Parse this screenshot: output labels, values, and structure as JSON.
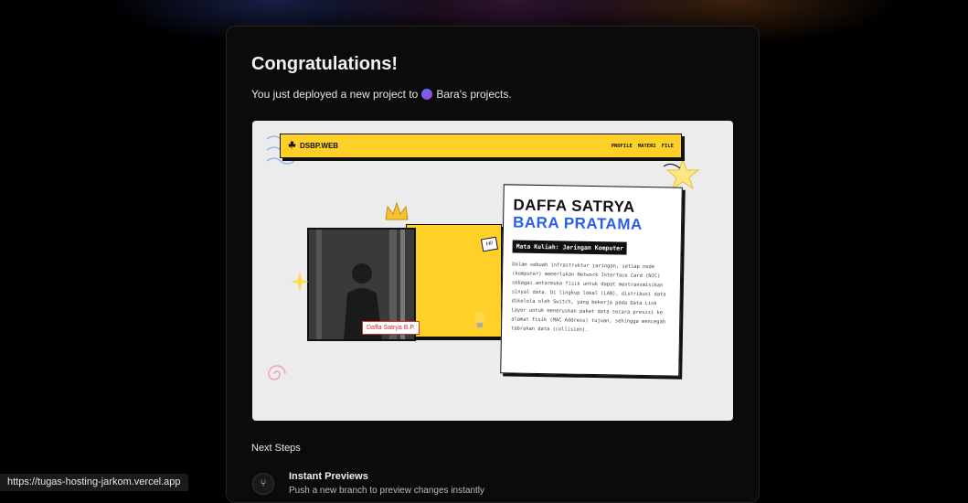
{
  "header": {
    "title": "Congratulations!",
    "subtitle_prefix": "You just deployed a new project to",
    "team_name": "Bara's projects."
  },
  "preview": {
    "brand": "DSBP.WEB",
    "nav": [
      "PROFILE",
      "MATERI",
      "FILE"
    ],
    "hi": "Hi!",
    "name_line1": "DAFFA SATRYA",
    "name_line2": "BARA PRATAMA",
    "course": "Mata Kuliah: Jaringan Komputer",
    "description": "Dalam sebuah infrastruktur jaringan, setiap node (komputer) memerlukan Network Interface Card (NIC) sebagai antarmuka fisik untuk dapat mentransmisikan sinyal data. Di lingkup lokal (LAN), distribusi data dikelola oleh Switch, yang bekerja pada Data Link Layer untuk meneruskan paket data secara presisi ke alamat fisik (MAC Address) tujuan, sehingga mencegah tabrakan data (collision).",
    "photo_caption": "Daffa Satrya B.P."
  },
  "next_steps": {
    "heading": "Next Steps",
    "items": [
      {
        "title": "Instant Previews",
        "description": "Push a new branch to preview changes instantly"
      }
    ]
  },
  "status_bar": {
    "url": "https://tugas-hosting-jarkom.vercel.app"
  },
  "colors": {
    "accent_yellow": "#ffd128",
    "accent_blue": "#2b5ee8",
    "background": "#000000"
  }
}
